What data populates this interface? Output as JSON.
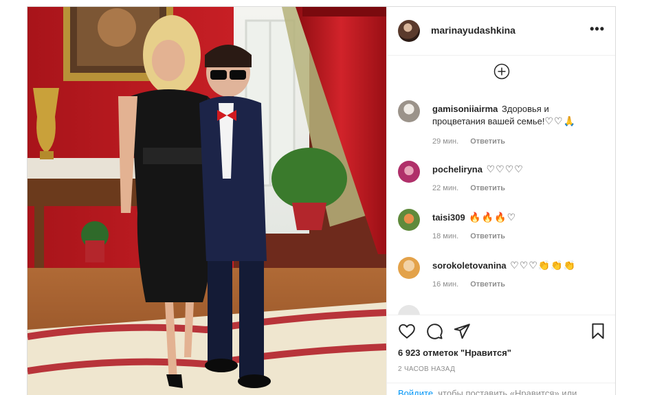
{
  "post": {
    "username": "marinayudashkina",
    "more_label": "•••",
    "photo_alt": "marinayudashkina",
    "add_icon": "plus-circle-icon"
  },
  "comments": [
    {
      "user": "gamisoniiairma",
      "text": "Здоровья и процветания вашей семье!",
      "emoji": "♡♡🙏",
      "time": "29 мин.",
      "reply": "Ответить",
      "avatar_color": "#c9c1b8"
    },
    {
      "user": "pocheliryna",
      "text": "",
      "emoji": "♡♡♡♡",
      "time": "22 мин.",
      "reply": "Ответить",
      "avatar_color": "#b0306a"
    },
    {
      "user": "taisi309",
      "text": "",
      "emoji": "🔥🔥🔥♡",
      "time": "18 мин.",
      "reply": "Ответить",
      "avatar_color": "#5f8a3c"
    },
    {
      "user": "sorokoletovanina",
      "text": "",
      "emoji": "♡♡♡👏👏👏",
      "time": "16 мин.",
      "reply": "Ответить",
      "avatar_color": "#e3a24a"
    }
  ],
  "actions": {
    "like_icon": "heart-icon",
    "comment_icon": "comment-icon",
    "share_icon": "paper-plane-icon",
    "save_icon": "bookmark-icon",
    "likes_text": "6 923 отметок \"Нравится\"",
    "time_text": "2 ЧАСОВ НАЗАД"
  },
  "login": {
    "link": "Войдите",
    "text": ", чтобы поставить «Нравится» или"
  },
  "colors": {
    "link": "#0095f6",
    "meta": "#8e8e8e",
    "border": "#dbdbdb"
  }
}
